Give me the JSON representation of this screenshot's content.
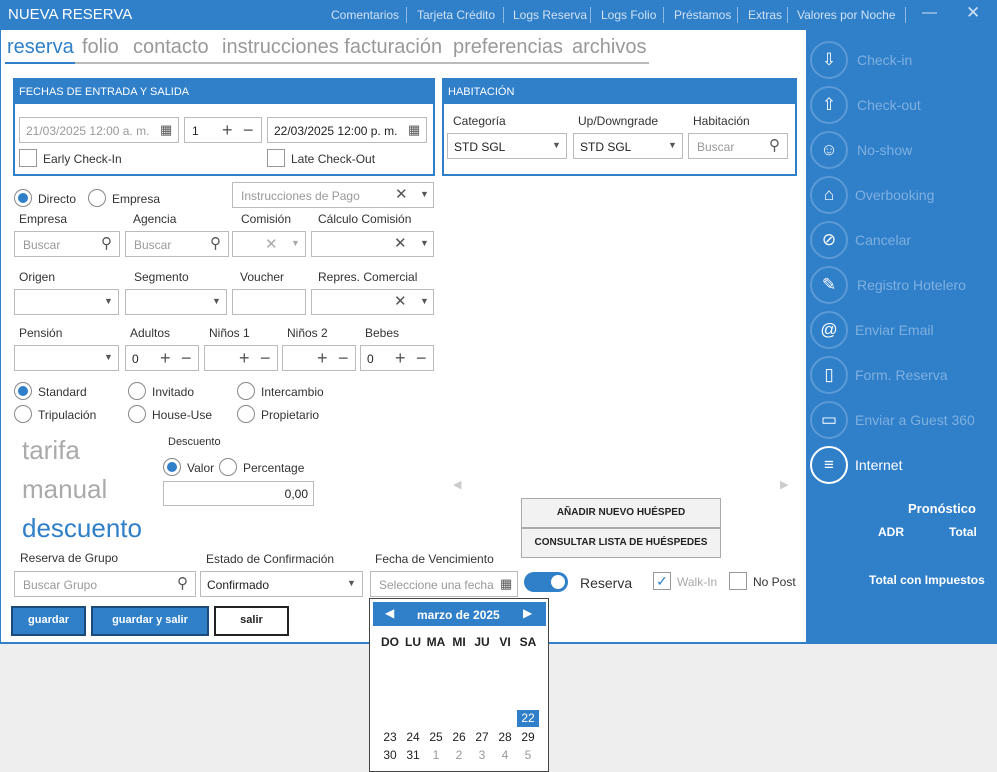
{
  "window": {
    "title": "NUEVA RESERVA",
    "min_icon": "minimize-icon",
    "close_icon": "close-icon"
  },
  "topnav": [
    "Comentarios",
    "Tarjeta Crédito",
    "Logs Reserva",
    "Logs Folio",
    "Préstamos",
    "Extras",
    "Valores por Noche"
  ],
  "tabs": [
    "reserva",
    "folio",
    "contacto",
    "instrucciones facturación",
    "preferencias",
    "archivos"
  ],
  "fechas": {
    "title": "FECHAS DE ENTRADA Y SALIDA",
    "checkin": "21/03/2025 12:00 a. m.",
    "nights": "1",
    "checkout": "22/03/2025 12:00 p. m.",
    "early": "Early Check-In",
    "late": "Late Check-Out"
  },
  "habitacion": {
    "title": "HABITACIÓN",
    "cat_label": "Categoría",
    "cat_value": "STD SGL",
    "up_label": "Up/Downgrade",
    "up_value": "STD SGL",
    "hab_label": "Habitación",
    "hab_ph": "Buscar"
  },
  "canal": {
    "directo": "Directo",
    "empresa": "Empresa",
    "instr_ph": "Instrucciones de Pago"
  },
  "labels": {
    "empresa": "Empresa",
    "agencia": "Agencia",
    "comision": "Comisión",
    "calc": "Cálculo Comisión",
    "origen": "Origen",
    "segmento": "Segmento",
    "voucher": "Voucher",
    "repres": "Repres. Comercial",
    "pension": "Pensión",
    "adultos": "Adultos",
    "ninos1": "Niños 1",
    "ninos2": "Niños 2",
    "bebes": "Bebes"
  },
  "buscar": "Buscar",
  "adultos_val": "0",
  "bebes_val": "0",
  "tipo": {
    "standard": "Standard",
    "invitado": "Invitado",
    "intercambio": "Intercambio",
    "tripulacion": "Tripulación",
    "house": "House-Use",
    "propietario": "Propietario"
  },
  "tarifa": {
    "l1": "tarifa",
    "l2": "manual",
    "l3": "descuento"
  },
  "descuento": {
    "label": "Descuento",
    "valor": "Valor",
    "percentage": "Percentage",
    "amount": "0,00"
  },
  "buttons": {
    "add_guest": "AÑADIR NUEVO HUÉSPED",
    "list_guest": "CONSULTAR LISTA DE HUÉSPEDES",
    "guardar": "guardar",
    "guardar_salir": "guardar y salir",
    "salir": "salir"
  },
  "grupo": {
    "label": "Reserva de Grupo",
    "ph": "Buscar Grupo"
  },
  "confirmacion": {
    "label": "Estado de Confirmación",
    "value": "Confirmado"
  },
  "vencimiento": {
    "label": "Fecha de Vencimiento",
    "ph": "Seleccione una fecha"
  },
  "toggles": {
    "reserva": "Reserva",
    "walkin": "Walk-In",
    "nopost": "No Post"
  },
  "calendar": {
    "month": "marzo de 2025",
    "dow": [
      "DO",
      "LU",
      "MA",
      "MI",
      "JU",
      "VI",
      "SA"
    ],
    "selected": "22",
    "row1": [
      "23",
      "24",
      "25",
      "26",
      "27",
      "28",
      "29"
    ],
    "row2": [
      "30",
      "31",
      "1",
      "2",
      "3",
      "4",
      "5"
    ]
  },
  "side": [
    {
      "label": "Check-in",
      "icon": "person-down-icon",
      "glyph": "⇩"
    },
    {
      "label": "Check-out",
      "icon": "person-up-icon",
      "glyph": "⇧"
    },
    {
      "label": "No-show",
      "icon": "person-search-icon",
      "glyph": "☺"
    },
    {
      "label": "Overbooking",
      "icon": "house-icon",
      "glyph": "⌂"
    },
    {
      "label": "Cancelar",
      "icon": "cancel-icon",
      "glyph": "⊘"
    },
    {
      "label": "Registro Hotelero",
      "icon": "edit-icon",
      "glyph": "✎"
    },
    {
      "label": "Enviar Email",
      "icon": "at-icon",
      "glyph": "@"
    },
    {
      "label": "Form. Reserva",
      "icon": "document-icon",
      "glyph": "▯"
    },
    {
      "label": "Enviar a Guest 360",
      "icon": "tablet-icon",
      "glyph": "▭"
    },
    {
      "label": "Internet",
      "icon": "server-icon",
      "glyph": "≡"
    }
  ],
  "pronostico": {
    "title": "Pronóstico",
    "adr": "ADR",
    "total": "Total",
    "impuestos": "Total con Impuestos"
  }
}
